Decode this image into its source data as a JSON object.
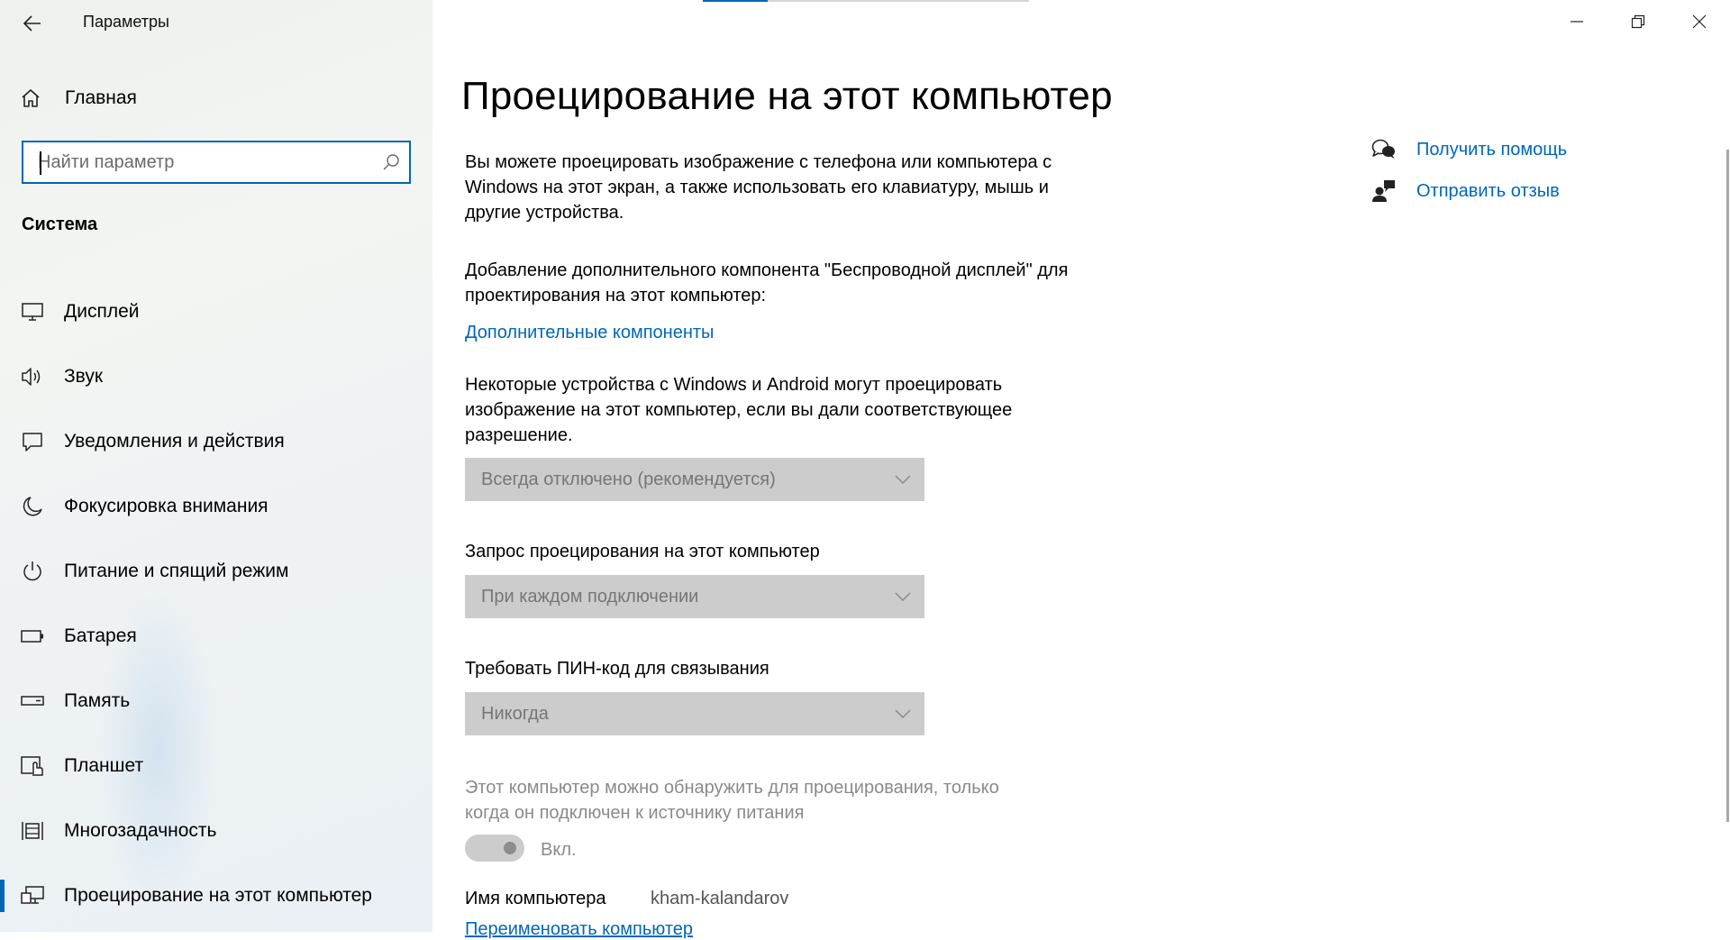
{
  "app": {
    "title": "Параметры"
  },
  "sidebar": {
    "home_label": "Главная",
    "search_placeholder": "Найти параметр",
    "section_title": "Система",
    "items": [
      {
        "label": "Дисплей",
        "icon": "monitor-icon"
      },
      {
        "label": "Звук",
        "icon": "speaker-icon"
      },
      {
        "label": "Уведомления и действия",
        "icon": "notification-icon"
      },
      {
        "label": "Фокусировка внимания",
        "icon": "moon-icon"
      },
      {
        "label": "Питание и спящий режим",
        "icon": "power-icon"
      },
      {
        "label": "Батарея",
        "icon": "battery-icon"
      },
      {
        "label": "Память",
        "icon": "storage-icon"
      },
      {
        "label": "Планшет",
        "icon": "tablet-icon"
      },
      {
        "label": "Многозадачность",
        "icon": "multitasking-icon"
      },
      {
        "label": "Проецирование на этот компьютер",
        "icon": "projecting-icon",
        "active": true
      }
    ]
  },
  "main": {
    "title": "Проецирование на этот компьютер",
    "intro": "Вы можете проецировать изображение с телефона или компьютера с Windows на этот экран, а также использовать его клавиатуру, мышь и другие устройства.",
    "addon_text": "Добавление дополнительного компонента \"Беспроводной дисплей\" для проектирования на этот компьютер:",
    "addon_link": "Дополнительные компоненты",
    "permission_text": "Некоторые устройства с Windows и Android могут проецировать изображение на этот компьютер, если вы дали соответствующее разрешение.",
    "permission_value": "Всегда отключено (рекомендуется)",
    "request_label": "Запрос проецирования на этот компьютер",
    "request_value": "При каждом подключении",
    "pin_label": "Требовать ПИН-код для связывания",
    "pin_value": "Никогда",
    "power_text": "Этот компьютер можно обнаружить для проецирования, только когда он подключен к источнику питания",
    "power_toggle_label": "Вкл.",
    "pc_name_label": "Имя компьютера",
    "pc_name_value": "kham-kalandarov",
    "rename_link": "Переименовать компьютер"
  },
  "help": {
    "get_help": "Получить помощь",
    "feedback": "Отправить отзыв"
  },
  "colors": {
    "accent": "#0067b8",
    "disabled_field": "#cccccc",
    "disabled_text": "#8a8a8a"
  }
}
